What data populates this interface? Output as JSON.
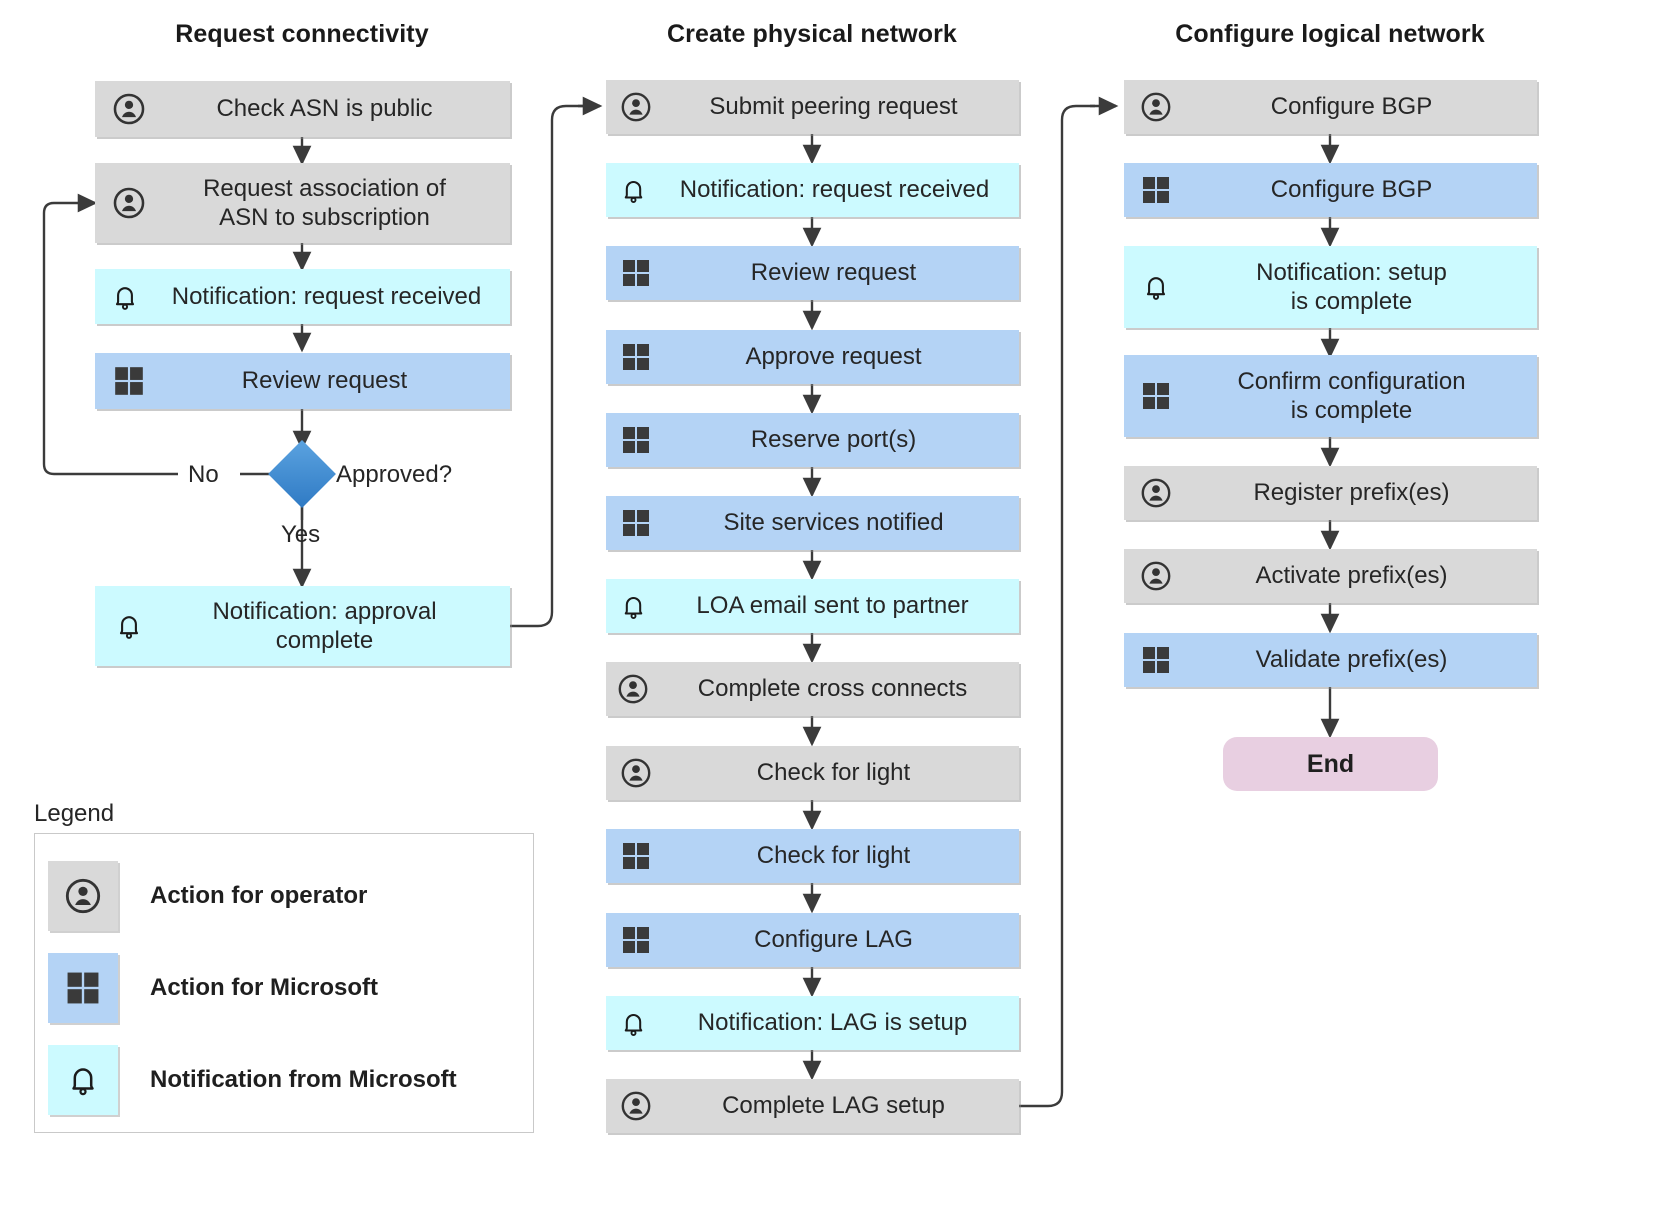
{
  "columns": [
    {
      "id": "request-connectivity",
      "title": "Request connectivity",
      "nodes": [
        {
          "id": "check-asn-is-public",
          "label": "Check ASN is public",
          "kind": "operator"
        },
        {
          "id": "request-association-of-asn",
          "label": "Request association of\nASN to subscription",
          "kind": "operator"
        },
        {
          "id": "notification-request-received",
          "label": "Notification: request received",
          "kind": "notification"
        },
        {
          "id": "review-request",
          "label": "Review request",
          "kind": "microsoft"
        },
        {
          "id": "notification-approval-complete",
          "label": "Notification: approval\ncomplete",
          "kind": "notification"
        }
      ],
      "decision": {
        "id": "approved",
        "label": "Approved?",
        "yes_label": "Yes",
        "no_label": "No"
      }
    },
    {
      "id": "create-physical-network",
      "title": "Create physical network",
      "nodes": [
        {
          "id": "submit-peering-request",
          "label": "Submit peering request",
          "kind": "operator"
        },
        {
          "id": "notification-request-received-2",
          "label": "Notification: request received",
          "kind": "notification"
        },
        {
          "id": "review-request-2",
          "label": "Review request",
          "kind": "microsoft"
        },
        {
          "id": "approve-request",
          "label": "Approve request",
          "kind": "microsoft"
        },
        {
          "id": "reserve-ports",
          "label": "Reserve port(s)",
          "kind": "microsoft"
        },
        {
          "id": "site-services-notified",
          "label": "Site services notified",
          "kind": "microsoft"
        },
        {
          "id": "loa-email-sent-to-partner",
          "label": "LOA email sent to partner",
          "kind": "notification"
        },
        {
          "id": "complete-cross-connects",
          "label": "Complete cross connects",
          "kind": "operator"
        },
        {
          "id": "check-for-light-operator",
          "label": "Check for light",
          "kind": "operator"
        },
        {
          "id": "check-for-light-microsoft",
          "label": "Check for light",
          "kind": "microsoft"
        },
        {
          "id": "configure-lag",
          "label": "Configure LAG",
          "kind": "microsoft"
        },
        {
          "id": "notification-lag-is-setup",
          "label": "Notification: LAG is setup",
          "kind": "notification"
        },
        {
          "id": "complete-lag-setup",
          "label": "Complete LAG setup",
          "kind": "operator"
        }
      ]
    },
    {
      "id": "configure-logical-network",
      "title": "Configure logical network",
      "nodes": [
        {
          "id": "configure-bgp-operator",
          "label": "Configure BGP",
          "kind": "operator"
        },
        {
          "id": "configure-bgp-microsoft",
          "label": "Configure BGP",
          "kind": "microsoft"
        },
        {
          "id": "notification-setup-complete",
          "label": "Notification: setup\nis complete",
          "kind": "notification"
        },
        {
          "id": "confirm-configuration",
          "label": "Confirm configuration\nis complete",
          "kind": "microsoft"
        },
        {
          "id": "register-prefixes",
          "label": "Register prefix(es)",
          "kind": "operator"
        },
        {
          "id": "activate-prefixes",
          "label": "Activate prefix(es)",
          "kind": "operator"
        },
        {
          "id": "validate-prefixes",
          "label": "Validate prefix(es)",
          "kind": "microsoft"
        }
      ],
      "terminator": {
        "id": "end",
        "label": "End"
      }
    }
  ],
  "legend": {
    "title": "Legend",
    "items": [
      {
        "id": "legend-operator",
        "icon": "person-circle-icon",
        "label": "Action for operator",
        "kind": "operator"
      },
      {
        "id": "legend-microsoft",
        "icon": "microsoft-logo-icon",
        "label": "Action for Microsoft",
        "kind": "microsoft"
      },
      {
        "id": "legend-notification",
        "icon": "bell-icon",
        "label": "Notification from Microsoft",
        "kind": "notification"
      }
    ]
  },
  "icons": {
    "operator": "person-circle-icon",
    "microsoft": "microsoft-logo-icon",
    "notification": "bell-icon"
  },
  "colors": {
    "operator_fill": "#d9d9d9",
    "microsoft_fill": "#b4d3f5",
    "notification_fill": "#ccfaff",
    "decision_fill": "#2f7ac4",
    "terminator_fill": "#e8cfe1",
    "connector_stroke": "#3b3b3b",
    "text": "#262626"
  }
}
